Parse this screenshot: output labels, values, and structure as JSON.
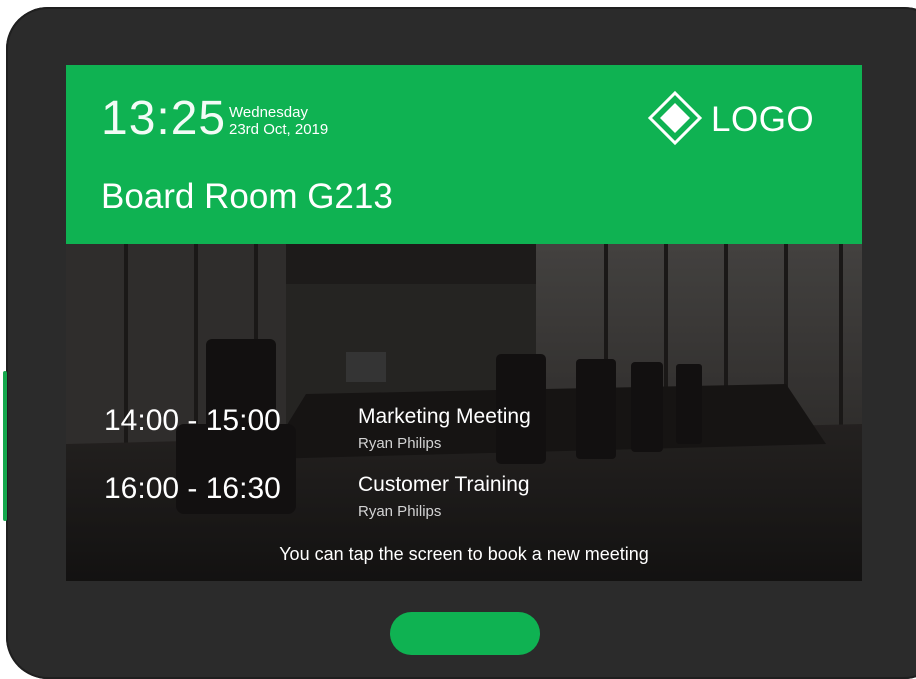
{
  "header": {
    "time": "13:25",
    "weekday": "Wednesday",
    "date": "23rd Oct, 2019",
    "logo_text": "LOGO",
    "room_name": "Board Room G213"
  },
  "bookings": [
    {
      "time": "14:00 - 15:00",
      "title": "Marketing Meeting",
      "host": "Ryan Philips"
    },
    {
      "time": "16:00 - 16:30",
      "title": "Customer Training",
      "host": "Ryan Philips"
    }
  ],
  "hint": "You can tap the screen to book a new meeting",
  "colors": {
    "accent": "#0fb252",
    "device": "#2b2b2b"
  },
  "icons": {
    "logo": "diamond-icon"
  }
}
